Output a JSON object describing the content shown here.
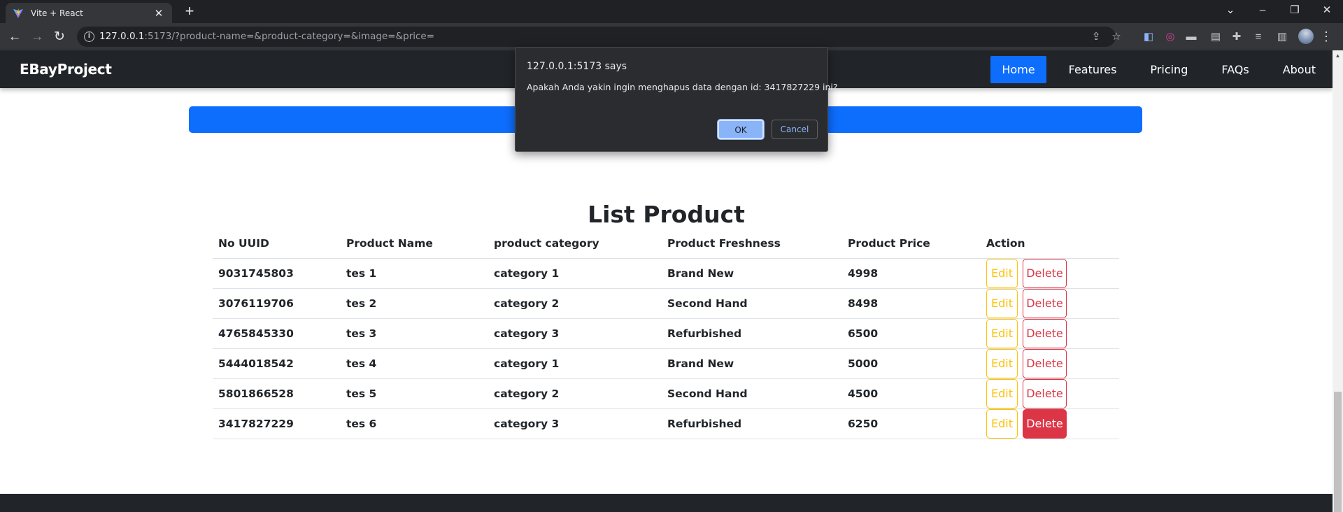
{
  "browser": {
    "tab_title": "Vite + React",
    "url_host": "127.0.0.1",
    "url_rest": ":5173/?product-name=&product-category=&image=&price="
  },
  "navbar": {
    "brand": "EBayProject",
    "links": [
      {
        "label": "Home",
        "active": true
      },
      {
        "label": "Features",
        "active": false
      },
      {
        "label": "Pricing",
        "active": false
      },
      {
        "label": "FAQs",
        "active": false
      },
      {
        "label": "About",
        "active": false
      }
    ]
  },
  "list": {
    "title": "List Product",
    "headers": [
      "No UUID",
      "Product Name",
      "product category",
      "Product Freshness",
      "Product Price",
      "Action"
    ],
    "rows": [
      {
        "uuid": "9031745803",
        "name": "tes 1",
        "category": "category 1",
        "freshness": "Brand New",
        "price": "4998"
      },
      {
        "uuid": "3076119706",
        "name": "tes 2",
        "category": "category 2",
        "freshness": "Second Hand",
        "price": "8498"
      },
      {
        "uuid": "4765845330",
        "name": "tes 3",
        "category": "category 3",
        "freshness": "Refurbished",
        "price": "6500"
      },
      {
        "uuid": "5444018542",
        "name": "tes 4",
        "category": "category 1",
        "freshness": "Brand New",
        "price": "5000"
      },
      {
        "uuid": "5801866528",
        "name": "tes 5",
        "category": "category 2",
        "freshness": "Second Hand",
        "price": "4500"
      },
      {
        "uuid": "3417827229",
        "name": "tes 6",
        "category": "category 3",
        "freshness": "Refurbished",
        "price": "6250"
      }
    ],
    "edit_label": "Edit",
    "delete_label": "Delete",
    "highlighted_delete_row": 5
  },
  "dialog": {
    "title": "127.0.0.1:5173 says",
    "message": "Apakah Anda yakin ingin menghapus data dengan id: 3417827229 ini?",
    "ok_label": "OK",
    "cancel_label": "Cancel"
  },
  "colors": {
    "navbar_bg": "#212529",
    "primary": "#0d6efd",
    "warning": "#ffc107",
    "danger": "#dc3545"
  }
}
